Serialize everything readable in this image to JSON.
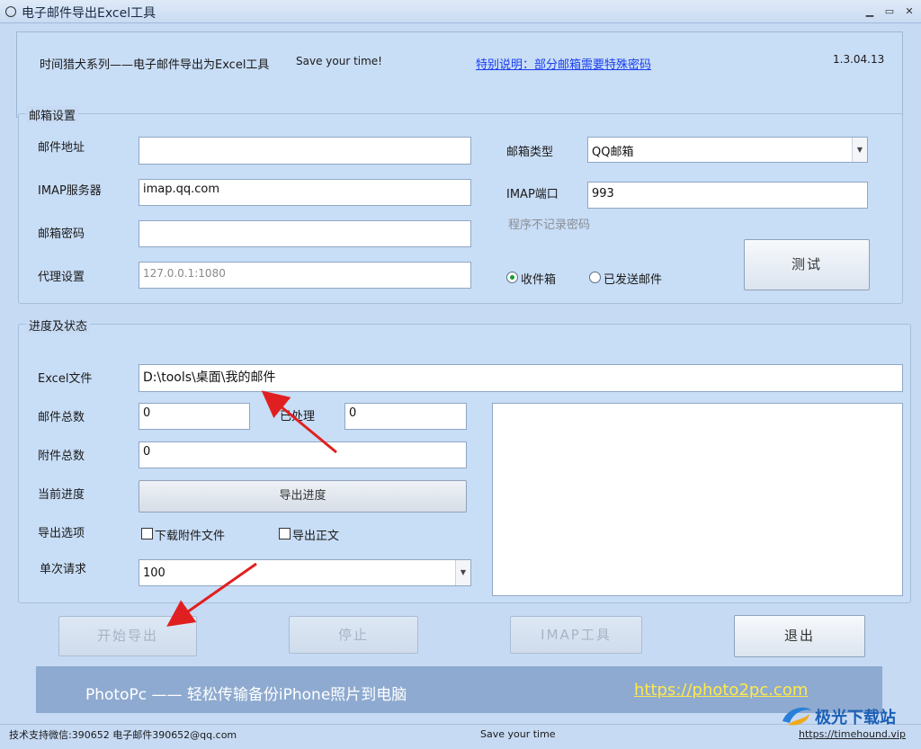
{
  "window": {
    "title": "电子邮件导出Excel工具"
  },
  "header": {
    "series": "时间猎犬系列——电子邮件导出为Excel工具",
    "slogan": "Save your time!",
    "notice_link": "特别说明：部分邮箱需要特殊密码",
    "version": "1.3.04.13"
  },
  "mail_settings": {
    "legend": "邮箱设置",
    "address_label": "邮件地址",
    "address_value": "",
    "imap_server_label": "IMAP服务器",
    "imap_server_value": "imap.qq.com",
    "password_label": "邮箱密码",
    "password_value": "",
    "proxy_label": "代理设置",
    "proxy_value": "127.0.0.1:1080",
    "type_label": "邮箱类型",
    "type_value": "QQ邮箱",
    "imap_port_label": "IMAP端口",
    "imap_port_value": "993",
    "no_record_note": "程序不记录密码",
    "inbox_label": "收件箱",
    "sent_label": "已发送邮件",
    "test_button": "测试"
  },
  "progress": {
    "legend": "进度及状态",
    "excel_label": "Excel文件",
    "excel_value": "D:\\tools\\桌面\\我的邮件",
    "total_label": "邮件总数",
    "total_value": "0",
    "processed_label": "已处理",
    "processed_value": "0",
    "attach_label": "附件总数",
    "attach_value": "0",
    "current_label": "当前进度",
    "progress_text": "导出进度",
    "progress_fraction": 0,
    "options_label": "导出选项",
    "download_attach_label": "下载附件文件",
    "export_body_label": "导出正文",
    "per_request_label": "单次请求",
    "per_request_value": "100"
  },
  "actions": {
    "start": "开始导出",
    "stop": "停止",
    "imap_tool": "IMAP工具",
    "exit": "退出"
  },
  "banner": {
    "text": "PhotoPc —— 轻松传输备份iPhone照片到电脑",
    "link": "https://photo2pc.com"
  },
  "status": {
    "support": "技术支持微信:390652  电子邮件390652@qq.com",
    "motto": "Save your time",
    "site": "https://timehound.vip"
  },
  "watermark": {
    "text": "极光下载站"
  },
  "colors": {
    "accent_link": "#1a3ff0",
    "arrow": "#e02020",
    "banner_link": "#ffe94a"
  }
}
